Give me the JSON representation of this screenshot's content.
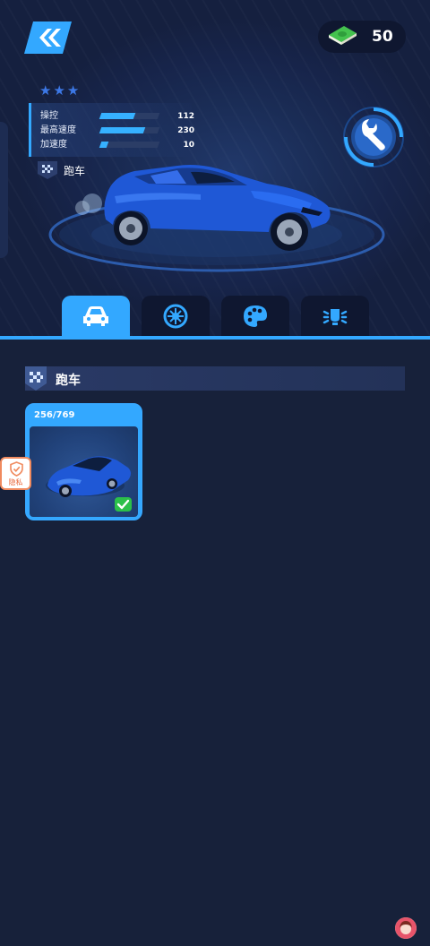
{
  "header": {
    "back_icon": "double-chevron-left-icon",
    "currency_icon": "cash-stack-icon",
    "currency_amount": "50"
  },
  "car": {
    "stars": 3,
    "type_label": "跑车",
    "stats": [
      {
        "label": "操控",
        "value": "112",
        "fill": 0.58
      },
      {
        "label": "最高速度",
        "value": "230",
        "fill": 0.75
      },
      {
        "label": "加速度",
        "value": "10",
        "fill": 0.12
      }
    ],
    "upgrade_icon": "wrench-icon"
  },
  "tabs": [
    {
      "icon": "car-body-icon",
      "active": true
    },
    {
      "icon": "wheel-icon",
      "active": false
    },
    {
      "icon": "paint-palette-icon",
      "active": false
    },
    {
      "icon": "headlight-icon",
      "active": false
    }
  ],
  "section": {
    "title": "跑车"
  },
  "cards": [
    {
      "count": "256/769",
      "selected": true
    }
  ],
  "privacy": {
    "label": "隐私"
  },
  "colors": {
    "accent": "#33a8ff",
    "background": "#17213a",
    "tab_inactive": "#0f1730",
    "check_green": "#2bc04a",
    "privacy_orange": "#f08a5e"
  }
}
